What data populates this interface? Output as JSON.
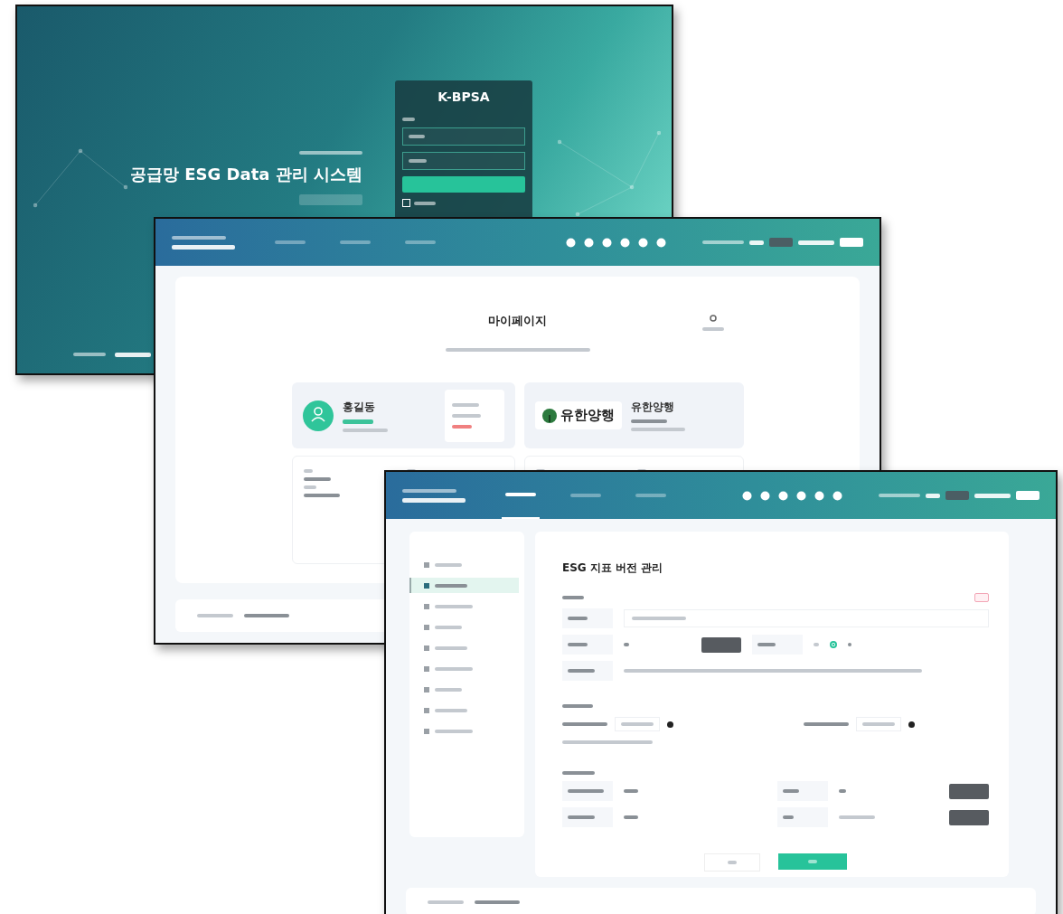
{
  "login_window": {
    "logo": "K-BPSA",
    "title": "공급망 ESG Data 관리 시스템",
    "remember_me": {
      "checked": false
    }
  },
  "mypage_window": {
    "nav_tabs": [
      {
        "selected": false
      },
      {
        "selected": false
      },
      {
        "selected": false
      }
    ],
    "page_title": "마이페이지",
    "user_card": {
      "name": "홍길동"
    },
    "company_card": {
      "logo_text": "유한양행",
      "name": "유한양행"
    }
  },
  "esg_window": {
    "nav_tabs": [
      {
        "selected": true
      },
      {
        "selected": false
      },
      {
        "selected": false
      }
    ],
    "sidebar": {
      "items": [
        {
          "selected": false
        },
        {
          "selected": true
        },
        {
          "selected": false
        },
        {
          "selected": false
        },
        {
          "selected": false
        },
        {
          "selected": false
        },
        {
          "selected": false
        },
        {
          "selected": false
        },
        {
          "selected": false
        }
      ]
    },
    "radio": {
      "selected": true
    },
    "page_title": "ESG 지표 버전 관리"
  }
}
